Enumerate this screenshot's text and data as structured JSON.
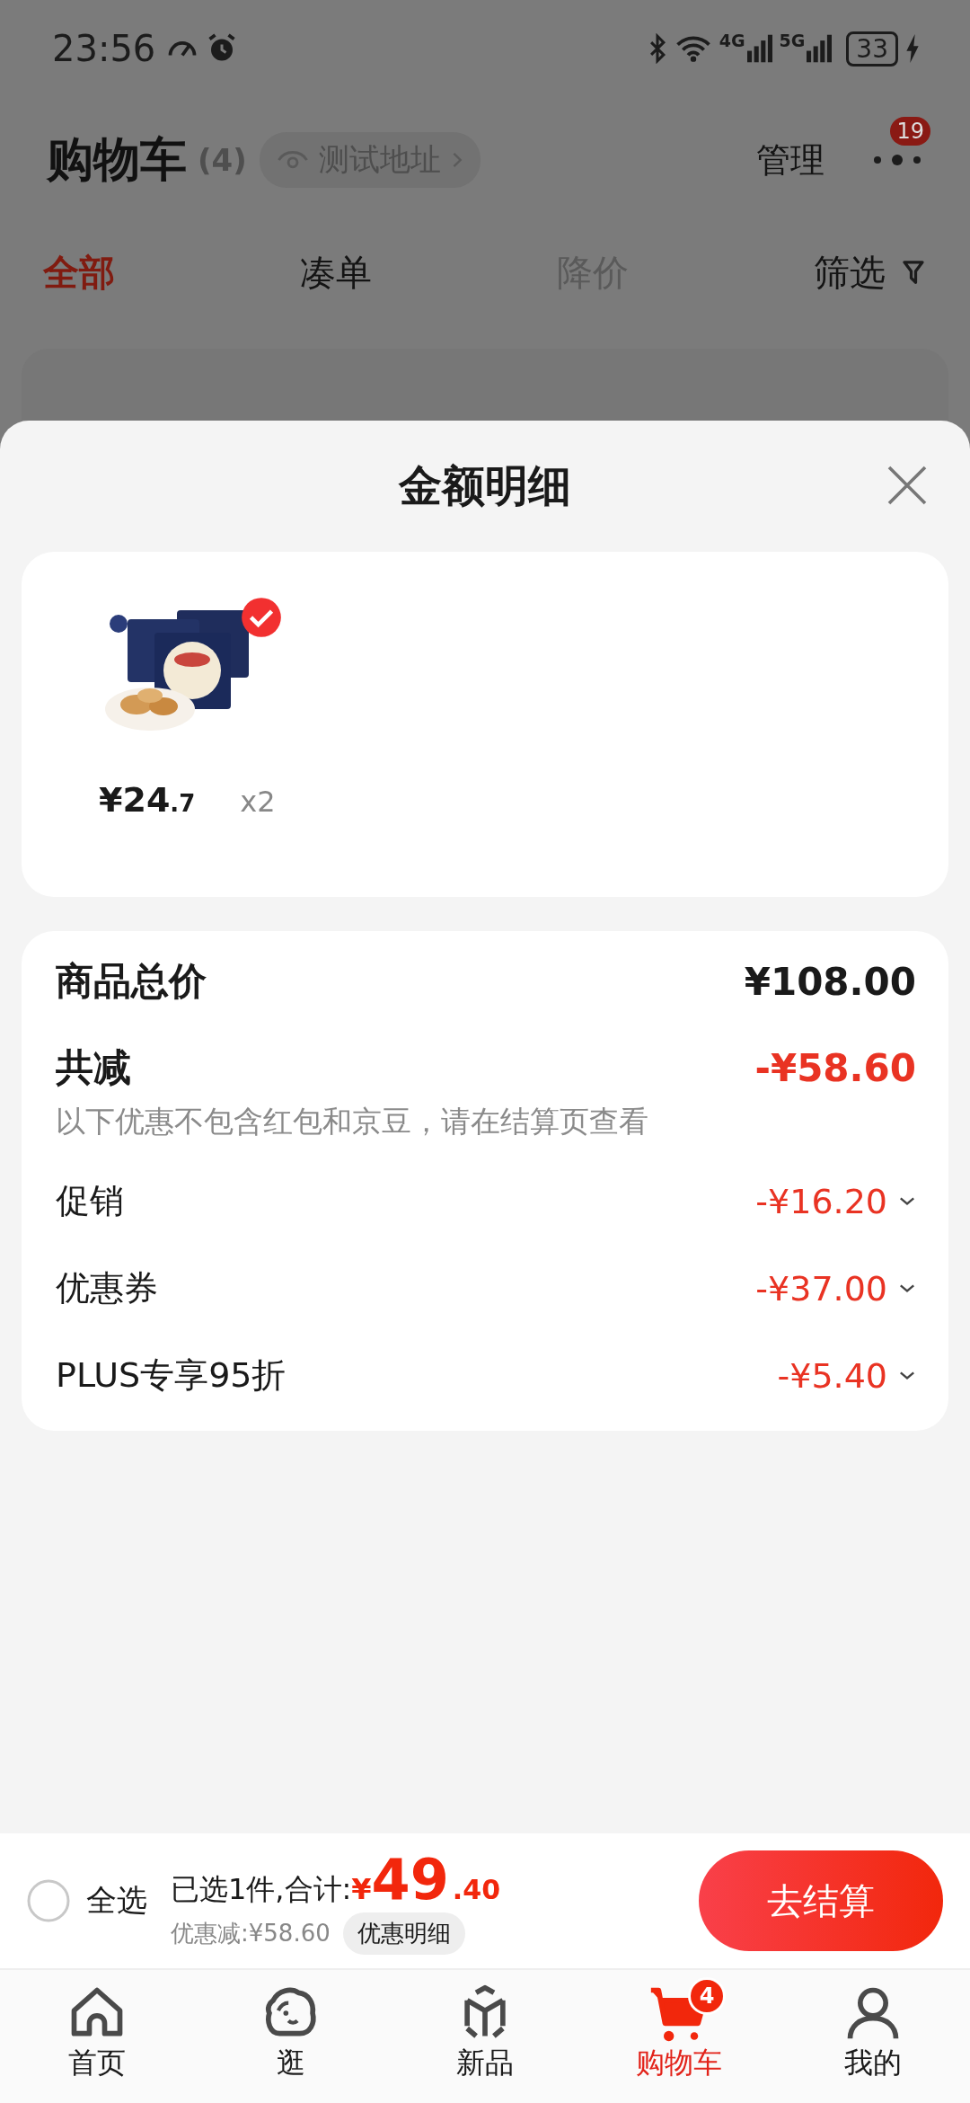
{
  "status_bar": {
    "time": "23:56",
    "network_1": "4G",
    "network_2": "5G",
    "battery": "33"
  },
  "header": {
    "title": "购物车",
    "count": "(4)",
    "address": "测试地址",
    "manage": "管理",
    "more_badge": "19"
  },
  "tabs": [
    {
      "label": "全部",
      "selected": true,
      "disabled": false
    },
    {
      "label": "凑单",
      "selected": false,
      "disabled": false
    },
    {
      "label": "降价",
      "selected": false,
      "disabled": true
    }
  ],
  "filter": {
    "label": "筛选"
  },
  "sheet": {
    "title": "金额明细",
    "products": [
      {
        "kind": "picture",
        "checked": true,
        "price_integer": "¥24",
        "price_decimal": ".7",
        "quantity": "x2"
      }
    ],
    "subtotal": {
      "label": "商品总价",
      "amount": "¥108.00"
    },
    "reduction": {
      "label": "共减",
      "amount": "-¥58.60",
      "note": "以下优惠不包含红包和京豆，请在结算页查看"
    },
    "discounts": [
      {
        "label": "促销",
        "amount": "-¥16.20",
        "expanded": false
      },
      {
        "label": "优惠券",
        "amount": "-¥37.00",
        "expanded": false
      },
      {
        "label": "PLUS专享95折",
        "amount": "-¥5.40",
        "expanded": false
      }
    ]
  },
  "checkout_bar": {
    "select_all": {
      "label": "全选",
      "checked": false
    },
    "summary_label": "已选1件,合计:",
    "total_currency": "¥",
    "total_integer": "49",
    "total_decimal": ".40",
    "saved": "优惠减:¥58.60",
    "details_button": "优惠明细",
    "checkout_button": "去结算"
  },
  "bottom_nav": [
    {
      "kind": "home",
      "label": "首页",
      "selected": false
    },
    {
      "kind": "stroll",
      "label": "逛",
      "selected": false
    },
    {
      "kind": "new",
      "label": "新品",
      "selected": false
    },
    {
      "kind": "cart",
      "label": "购物车",
      "selected": true,
      "badge": "4"
    },
    {
      "kind": "me",
      "label": "我的",
      "selected": false
    }
  ]
}
